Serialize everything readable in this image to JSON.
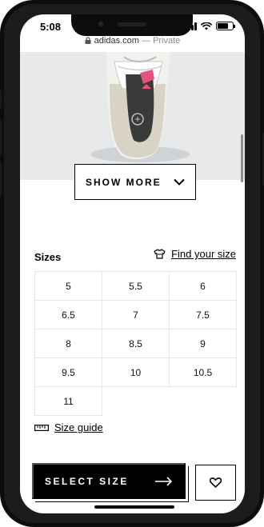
{
  "status_bar": {
    "time": "5:08",
    "icons": [
      "signal-icon",
      "wifi-icon",
      "battery-icon"
    ]
  },
  "browser": {
    "domain": "adidas.com",
    "separator": "—",
    "mode": "Private"
  },
  "product": {
    "image_icon": "shoe-image",
    "show_more_label": "SHOW MORE",
    "show_more_icon": "chevron-down-icon"
  },
  "sizes": {
    "heading": "Sizes",
    "find_size_label": "Find your size",
    "find_size_icon": "shirt-icon",
    "options": [
      "5",
      "5.5",
      "6",
      "6.5",
      "7",
      "7.5",
      "8",
      "8.5",
      "9",
      "9.5",
      "10",
      "10.5",
      "11"
    ],
    "size_guide_label": "Size guide",
    "size_guide_icon": "ruler-icon"
  },
  "actions": {
    "select_size_label": "SELECT SIZE",
    "select_size_icon": "arrow-right-icon",
    "wishlist_icon": "heart-icon"
  },
  "colors": {
    "brand_black": "#000000",
    "image_background": "#e7e9ea",
    "accent_pink": "#e8527e"
  }
}
